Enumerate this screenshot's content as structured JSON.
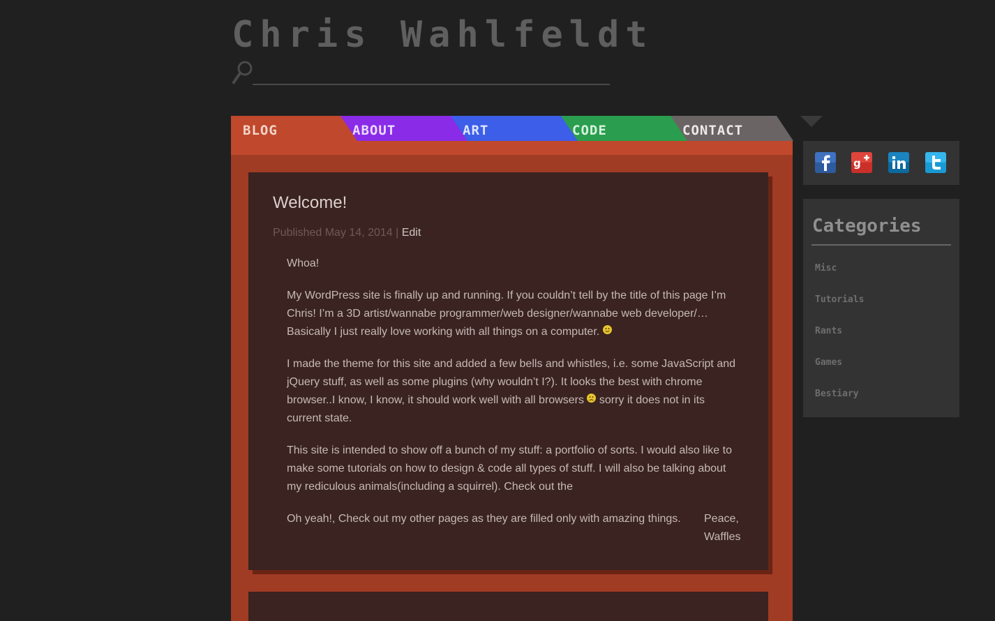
{
  "site": {
    "title": "Chris Wahlfeldt"
  },
  "search": {
    "placeholder": "",
    "value": ""
  },
  "nav": {
    "tabs": [
      {
        "label": "BLOG",
        "color": "#c0482c"
      },
      {
        "label": "ABOUT",
        "color": "#8a2be8"
      },
      {
        "label": "ART",
        "color": "#3c5ee8"
      },
      {
        "label": "CODE",
        "color": "#2a9e4e"
      },
      {
        "label": "CONTACT",
        "color": "#6b6464"
      }
    ]
  },
  "post": {
    "title": "Welcome!",
    "meta_prefix": "Published May 14, 2014 | ",
    "edit_label": "Edit",
    "paragraphs": [
      "Whoa!",
      "My WordPress site is finally up and running. If you couldn’t tell by the title of this page I’m Chris! I’m a 3D artist/wannabe programmer/web designer/wannabe web developer/… Basically I just really love working with all things on a computer. ",
      "I made the theme for this site and added a few bells and whistles, i.e. some JavaScript and jQuery stuff, as well as some plugins (why wouldn’t I?). It looks the best with chrome browser..I know, I know, it should work well with all browsers ",
      " sorry it does not in its current state.",
      "This site is intended to show off a bunch of my stuff: a portfolio of sorts. I would also like to make some tutorials on how to design & code all types of stuff. I will also be talking about my rediculous animals(including a squirrel). Check out the"
    ],
    "closing_text": "Oh yeah!, Check out my other pages as they are filled only with amazing things.",
    "signoff_line1": "Peace,",
    "signoff_line2": "Waffles"
  },
  "social": {
    "icons": [
      "facebook-icon",
      "google-plus-icon",
      "linkedin-icon",
      "twitter-icon"
    ]
  },
  "categories": {
    "title": "Categories",
    "items": [
      "Misc",
      "Tutorials",
      "Rants",
      "Games",
      "Bestiary"
    ]
  }
}
